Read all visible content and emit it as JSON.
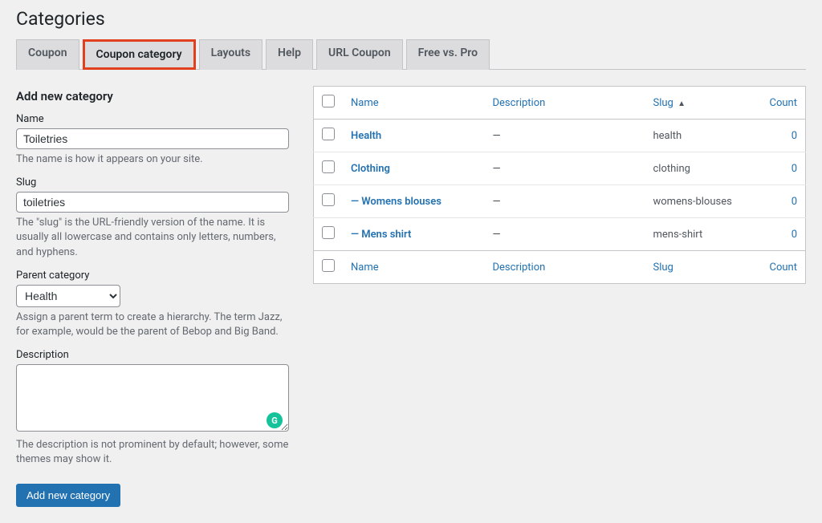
{
  "pageTitle": "Categories",
  "tabs": [
    {
      "label": "Coupon"
    },
    {
      "label": "Coupon category"
    },
    {
      "label": "Layouts"
    },
    {
      "label": "Help"
    },
    {
      "label": "URL Coupon"
    },
    {
      "label": "Free vs. Pro"
    }
  ],
  "form": {
    "title": "Add new category",
    "nameLabel": "Name",
    "nameValue": "Toiletries",
    "nameHint": "The name is how it appears on your site.",
    "slugLabel": "Slug",
    "slugValue": "toiletries",
    "slugHint": "The \"slug\" is the URL-friendly version of the name. It is usually all lowercase and contains only letters, numbers, and hyphens.",
    "parentLabel": "Parent category",
    "parentValue": "Health",
    "parentHint": "Assign a parent term to create a hierarchy. The term Jazz, for example, would be the parent of Bebop and Big Band.",
    "descLabel": "Description",
    "descValue": "",
    "descHint": "The description is not prominent by default; however, some themes may show it.",
    "submitLabel": "Add new category"
  },
  "table": {
    "headers": {
      "name": "Name",
      "description": "Description",
      "slug": "Slug",
      "count": "Count"
    },
    "sortIndicator": "▲",
    "rows": [
      {
        "name": "Health",
        "desc": "—",
        "slug": "health",
        "count": "0"
      },
      {
        "name": "Clothing",
        "desc": "—",
        "slug": "clothing",
        "count": "0"
      },
      {
        "name": "— Womens blouses",
        "desc": "—",
        "slug": "womens-blouses",
        "count": "0"
      },
      {
        "name": "— Mens shirt",
        "desc": "—",
        "slug": "mens-shirt",
        "count": "0"
      }
    ]
  },
  "gBadge": "G"
}
